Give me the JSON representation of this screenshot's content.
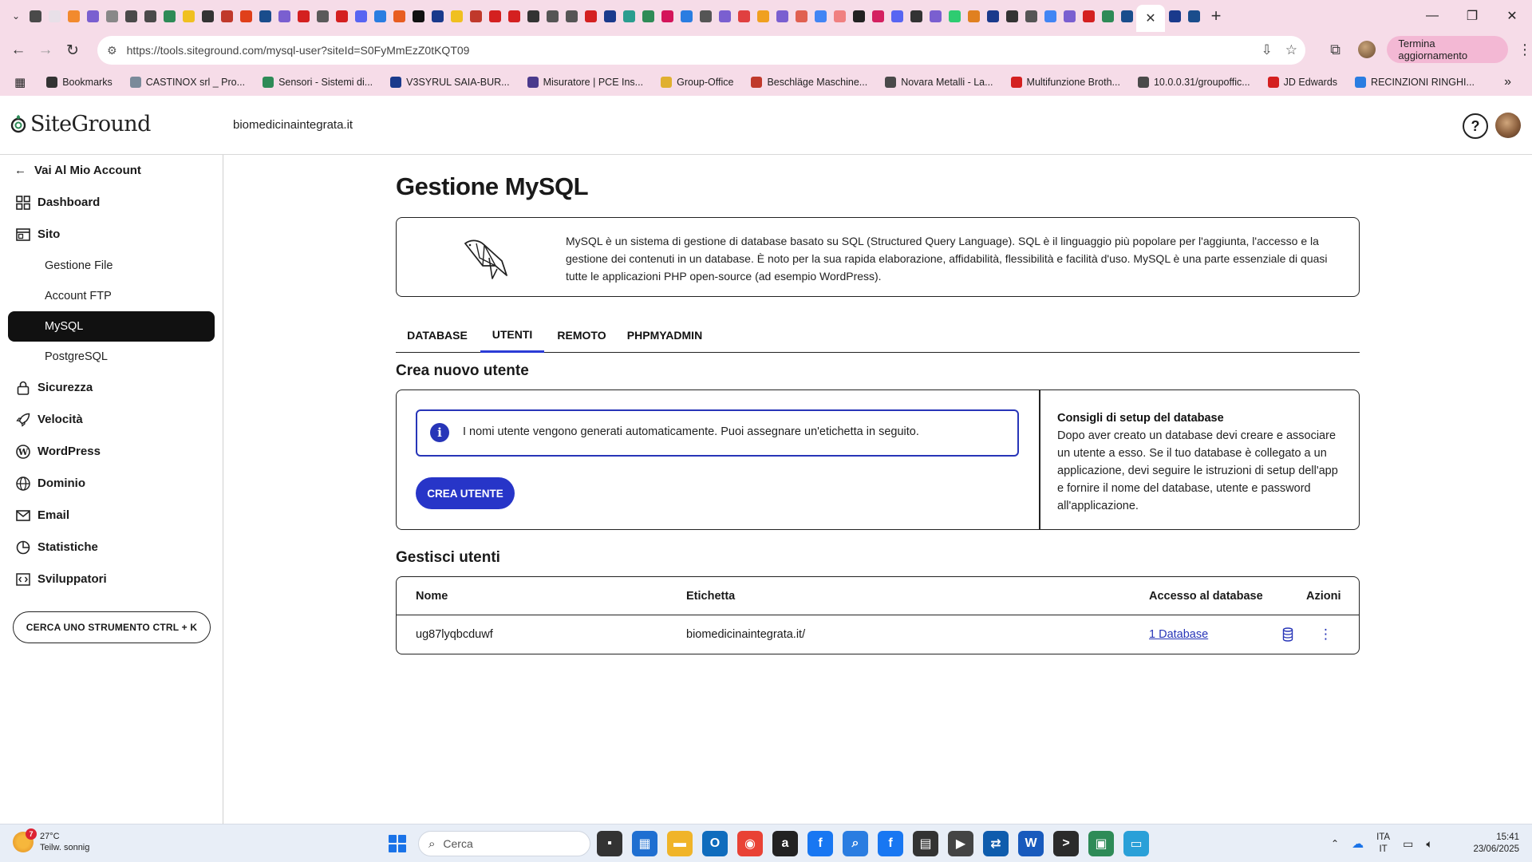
{
  "browser": {
    "tab_favicons": [
      "#4a4a4a",
      "#e8e0e8",
      "#f28a2e",
      "#7a5fd0",
      "#888888",
      "#4a4a4a",
      "#4a4a4a",
      "#2e8b57",
      "#f0c020",
      "#333333",
      "#c0392b",
      "#e0401a",
      "#1a4d8c",
      "#7a5fd0",
      "#d42020",
      "#5a5a5a",
      "#d42020",
      "#5865f2",
      "#2a7de1",
      "#e85d20",
      "#111111",
      "#1a3a8c",
      "#f0c020",
      "#c0392b",
      "#d42020",
      "#d42020",
      "#333333",
      "#555555",
      "#555555",
      "#d42020",
      "#1a3a8c",
      "#2a9d8f",
      "#2e8b57",
      "#d4145a",
      "#2a7de1",
      "#555555",
      "#7a5fd0",
      "#e04040",
      "#f0a020",
      "#7a5fd0",
      "#e06050",
      "#4285f4",
      "#f08080",
      "#222222",
      "#d42060",
      "#5865f2",
      "#333333",
      "#7a5fd0",
      "#2ecc71",
      "#e08020",
      "#1a3a8c",
      "#333333",
      "#555555",
      "#4285f4",
      "#7a5fd0",
      "#d42020",
      "#2e8b57",
      "#1a4d8c"
    ],
    "close_tab_glyph": "✕",
    "new_tab_glyph": "+",
    "url": "https://tools.siteground.com/mysql-user?siteId=S0FyMmEzZ0tKQT09",
    "update_label": "Termina aggiornamento",
    "bookmarks": [
      {
        "label": "Bookmarks",
        "color": "#333333"
      },
      {
        "label": "CASTINOX srl _ Pro...",
        "color": "#7a8a9a"
      },
      {
        "label": "Sensori - Sistemi di...",
        "color": "#2e8b57"
      },
      {
        "label": "V3SYRUL SAIA-BUR...",
        "color": "#1a3a8c"
      },
      {
        "label": "Misuratore | PCE Ins...",
        "color": "#4a3a8c"
      },
      {
        "label": "Group-Office",
        "color": "#e0b030"
      },
      {
        "label": "Beschläge Maschine...",
        "color": "#c0392b"
      },
      {
        "label": "Novara Metalli - La...",
        "color": "#4a4a4a"
      },
      {
        "label": "Multifunzione Broth...",
        "color": "#d42020"
      },
      {
        "label": "10.0.0.31/groupoffic...",
        "color": "#4a4a4a"
      },
      {
        "label": "JD Edwards",
        "color": "#d42020"
      },
      {
        "label": "RECINZIONI RINGHI...",
        "color": "#2a7de1"
      }
    ]
  },
  "header": {
    "logo_text": "SiteGround",
    "site_name": "biomedicinaintegrata.it",
    "help_glyph": "?"
  },
  "sidebar": {
    "back_label": "Vai Al Mio Account",
    "dashboard": "Dashboard",
    "site": "Sito",
    "sub_items": [
      "Gestione File",
      "Account FTP",
      "MySQL",
      "PostgreSQL"
    ],
    "security": "Sicurezza",
    "speed": "Velocità",
    "wordpress": "WordPress",
    "domain": "Dominio",
    "email": "Email",
    "stats": "Statistiche",
    "devs": "Sviluppatori",
    "search_tool": "CERCA UNO STRUMENTO CTRL + K"
  },
  "main": {
    "title": "Gestione MySQL",
    "description": "MySQL è un sistema di gestione di database basato su SQL (Structured Query Language). SQL è il linguaggio più popolare per l'aggiunta, l'accesso e la gestione dei contenuti in un database. È noto per la sua rapida elaborazione, affidabilità, flessibilità e facilità d'uso. MySQL è una parte essenziale di quasi tutte le applicazioni PHP open-source (ad esempio WordPress).",
    "tabs": [
      "DATABASE",
      "UTENTI",
      "REMOTO",
      "PHPMYADMIN"
    ],
    "active_tab": "UTENTI",
    "create_title": "Crea nuovo utente",
    "notice": "I nomi utente vengono generati automaticamente. Puoi assegnare un'etichetta in seguito.",
    "notice_glyph": "i",
    "create_button": "CREA UTENTE",
    "tips_title": "Consigli di setup del database",
    "tips_body": "Dopo aver creato un database devi creare e associare un utente a esso. Se il tuo database è collegato a un applicazione, devi seguire le istruzioni di setup dell'app e fornire il nome del database, utente e password all'applicazione.",
    "manage_title": "Gestisci utenti",
    "table": {
      "headers": [
        "Nome",
        "Etichetta",
        "Accesso al database",
        "Azioni"
      ],
      "rows": [
        {
          "name": "ug87lyqbcduwf",
          "label": "biomedicinaintegrata.it/",
          "access": "1 Database"
        }
      ]
    }
  },
  "taskbar": {
    "weather_temp": "27°C",
    "weather_desc": "Teilw. sonnig",
    "weather_badge": "7",
    "search_placeholder": "Cerca",
    "apps": [
      {
        "name": "file-explorer-dark",
        "color": "#333333",
        "glyph": "▪"
      },
      {
        "name": "hp-app",
        "color": "#1f6fd1",
        "glyph": "▦"
      },
      {
        "name": "folder",
        "color": "#f0b429",
        "glyph": "▬"
      },
      {
        "name": "outlook",
        "color": "#0f6cbd",
        "glyph": "O"
      },
      {
        "name": "chrome",
        "color": "#e94235",
        "glyph": "◉"
      },
      {
        "name": "amazon",
        "color": "#222222",
        "glyph": "a"
      },
      {
        "name": "facebook",
        "color": "#1877f2",
        "glyph": "f"
      },
      {
        "name": "search-app",
        "color": "#2a7de1",
        "glyph": "⌕"
      },
      {
        "name": "facebook-2",
        "color": "#1877f2",
        "glyph": "f"
      },
      {
        "name": "store",
        "color": "#333333",
        "glyph": "▤"
      },
      {
        "name": "media",
        "color": "#444444",
        "glyph": "▶"
      },
      {
        "name": "teamviewer",
        "color": "#0e5cad",
        "glyph": "⇄"
      },
      {
        "name": "word",
        "color": "#185abd",
        "glyph": "W"
      },
      {
        "name": "terminal",
        "color": "#2b2b2b",
        "glyph": ">"
      },
      {
        "name": "network-app",
        "color": "#2e8b57",
        "glyph": "▣"
      },
      {
        "name": "remote-app",
        "color": "#2aa0d8",
        "glyph": "▭"
      }
    ],
    "lang_top": "ITA",
    "lang_bottom": "IT",
    "time": "15:41",
    "date": "23/06/2025"
  }
}
